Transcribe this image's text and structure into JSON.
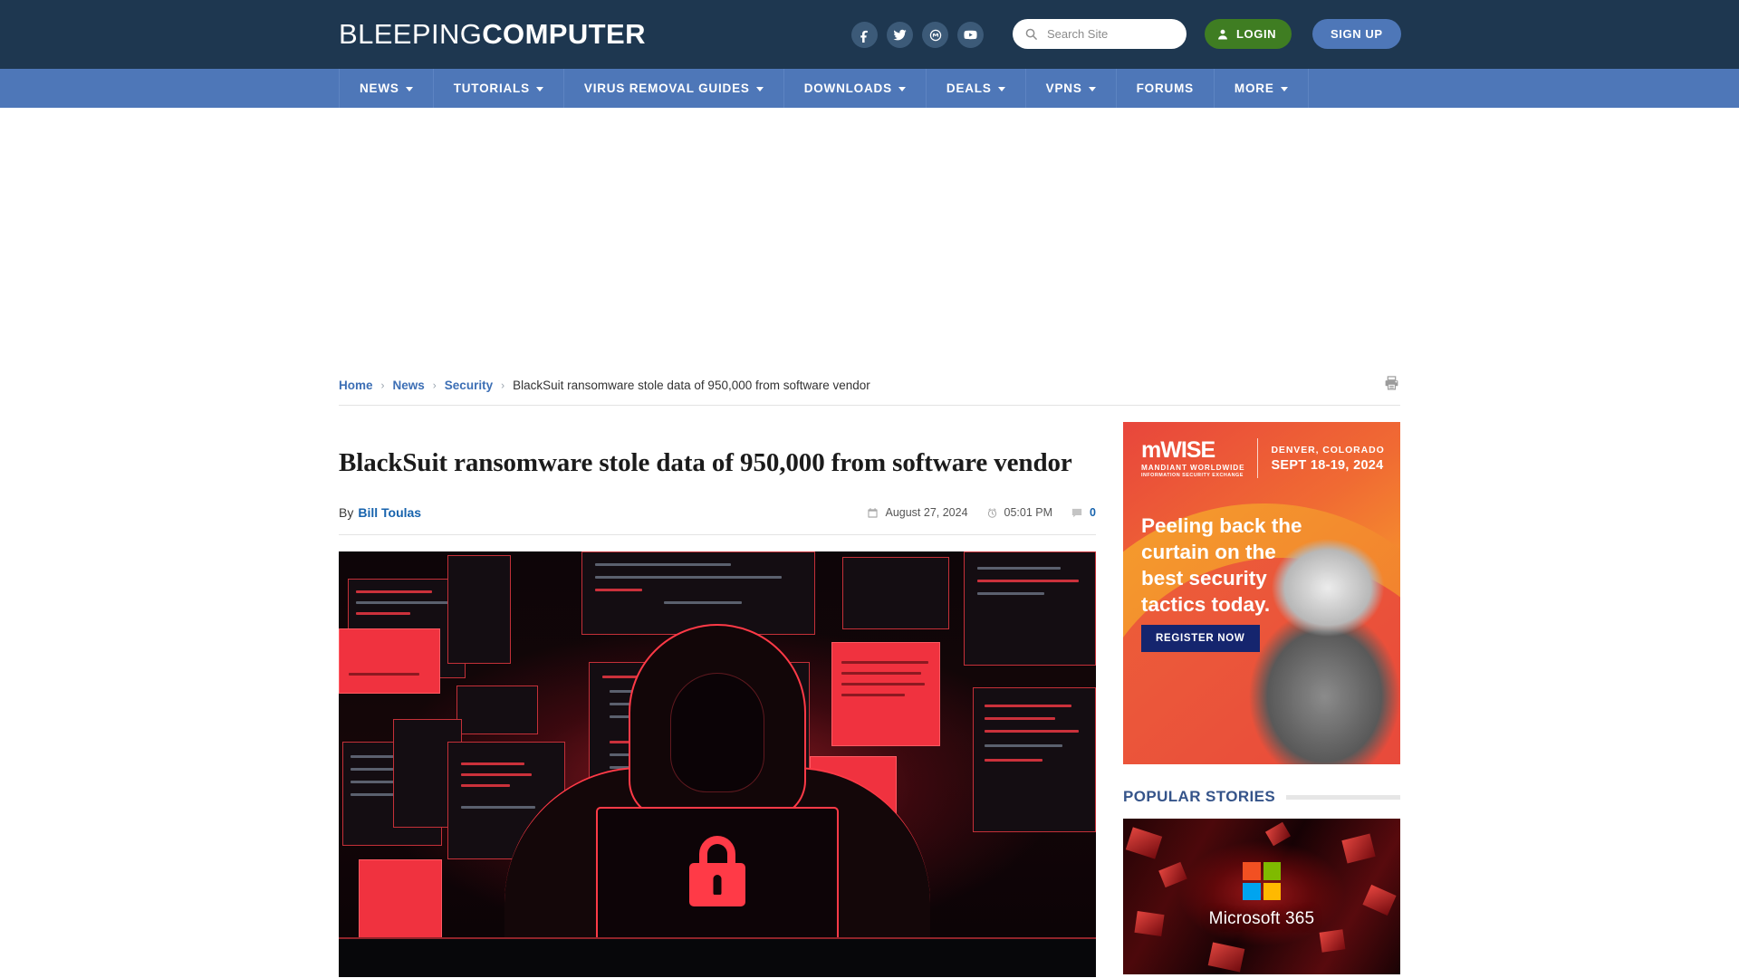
{
  "site": {
    "logo_thin": "BLEEPING",
    "logo_bold": "COMPUTER",
    "accent_navy": "#1e3750",
    "accent_blue": "#4e77b8",
    "link_blue": "#1763ad",
    "login_green": "#3f7d22"
  },
  "header": {
    "socials": [
      {
        "name": "facebook-icon",
        "label": "Facebook"
      },
      {
        "name": "twitter-icon",
        "label": "Twitter"
      },
      {
        "name": "mastodon-icon",
        "label": "Mastodon"
      },
      {
        "name": "youtube-icon",
        "label": "YouTube"
      }
    ],
    "search": {
      "placeholder": "Search Site",
      "value": "",
      "icon": "search-icon"
    },
    "login_label": "LOGIN",
    "signup_label": "SIGN UP"
  },
  "nav": [
    {
      "label": "NEWS",
      "has_dropdown": true
    },
    {
      "label": "TUTORIALS",
      "has_dropdown": true
    },
    {
      "label": "VIRUS REMOVAL GUIDES",
      "has_dropdown": true
    },
    {
      "label": "DOWNLOADS",
      "has_dropdown": true
    },
    {
      "label": "DEALS",
      "has_dropdown": true
    },
    {
      "label": "VPNS",
      "has_dropdown": true
    },
    {
      "label": "FORUMS",
      "has_dropdown": false
    },
    {
      "label": "MORE",
      "has_dropdown": true
    }
  ],
  "breadcrumb": {
    "items": [
      {
        "label": "Home",
        "link": true
      },
      {
        "label": "News",
        "link": true
      },
      {
        "label": "Security",
        "link": true
      },
      {
        "label": "BlackSuit ransomware stole data of 950,000 from software vendor",
        "link": false
      }
    ],
    "separator": "›",
    "print_icon": "printer-icon"
  },
  "article": {
    "headline": "BlackSuit ransomware stole data of 950,000 from software vendor",
    "by_prefix": "By",
    "author": "Bill Toulas",
    "date": "August 27, 2024",
    "time": "05:01 PM",
    "comment_count": "0",
    "date_icon": "calendar-icon",
    "time_icon": "clock-icon",
    "comment_icon": "comment-icon",
    "hero_alt": "Hooded hacker at a laptop displaying a padlock, surrounded by red code screens"
  },
  "sidebar": {
    "ad": {
      "brand_word": "mWISE",
      "brand_sub1": "MANDIANT WORLDWIDE",
      "brand_sub2": "INFORMATION SECURITY EXCHANGE",
      "city": "DENVER, COLORADO",
      "date": "SEPT 18-19, 2024",
      "headline": "Peeling back the curtain on the best security tactics today.",
      "cta": "REGISTER NOW"
    },
    "popular_title": "POPULAR STORIES",
    "stories": [
      {
        "image_label": "Microsoft 365"
      }
    ]
  }
}
